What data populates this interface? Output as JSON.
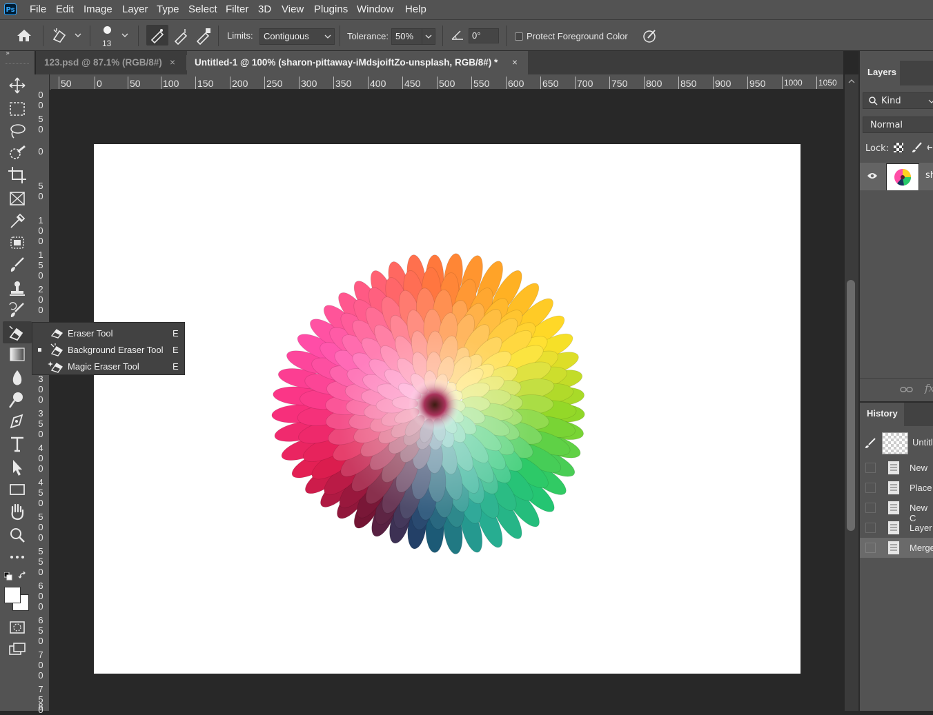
{
  "app": {
    "logo": "Ps"
  },
  "menu": [
    "File",
    "Edit",
    "Image",
    "Layer",
    "Type",
    "Select",
    "Filter",
    "3D",
    "View",
    "Plugins",
    "Window",
    "Help"
  ],
  "options": {
    "brush_size": "13",
    "limits_label": "Limits:",
    "limits_value": "Contiguous",
    "tolerance_label": "Tolerance:",
    "tolerance_value": "50%",
    "angle_value": "0°",
    "protect_label": "Protect Foreground Color"
  },
  "tabs": [
    {
      "label": "123.psd @ 87.1% (RGB/8#)",
      "active": false
    },
    {
      "label": "Untitled-1 @ 100% (sharon-pittaway-iMdsjoiftZo-unsplash, RGB/8#) *",
      "active": true
    }
  ],
  "ruler_h": [
    "50",
    "0",
    "50",
    "100",
    "150",
    "200",
    "250",
    "300",
    "350",
    "400",
    "450",
    "500",
    "550",
    "600",
    "650",
    "700",
    "750",
    "800",
    "850",
    "900",
    "950",
    "1000",
    "1050"
  ],
  "ruler_v": [
    "0",
    "0",
    "5",
    "0",
    "0",
    "5",
    "0",
    "1",
    "0",
    "0",
    "1",
    "5",
    "0",
    "2",
    "0",
    "0",
    "3",
    "0",
    "0",
    "3",
    "5",
    "0",
    "4",
    "0",
    "0",
    "4",
    "5",
    "0",
    "5",
    "0",
    "0",
    "5",
    "5",
    "0",
    "6",
    "0",
    "0",
    "6",
    "5",
    "0",
    "7",
    "0",
    "0",
    "7",
    "5",
    "0",
    "8"
  ],
  "flyout": [
    {
      "label": "Eraser Tool",
      "key": "E",
      "icon": "eraser-icon",
      "selected": false
    },
    {
      "label": "Background Eraser Tool",
      "key": "E",
      "icon": "background-eraser-icon",
      "selected": true
    },
    {
      "label": "Magic Eraser Tool",
      "key": "E",
      "icon": "magic-eraser-icon",
      "selected": false
    }
  ],
  "layers_panel": {
    "title": "Layers",
    "kind_label": "Kind",
    "blend_mode": "Normal",
    "lock_label": "Lock:",
    "layer_name": "sh"
  },
  "history_panel": {
    "title": "History",
    "snapshot": "Untitle",
    "items": [
      "New",
      "Place",
      "New C",
      "Layer",
      "Merge"
    ]
  },
  "colors": {
    "ui_bg": "#535353",
    "dark_bg": "#282828",
    "accent": "#31a8ff"
  }
}
